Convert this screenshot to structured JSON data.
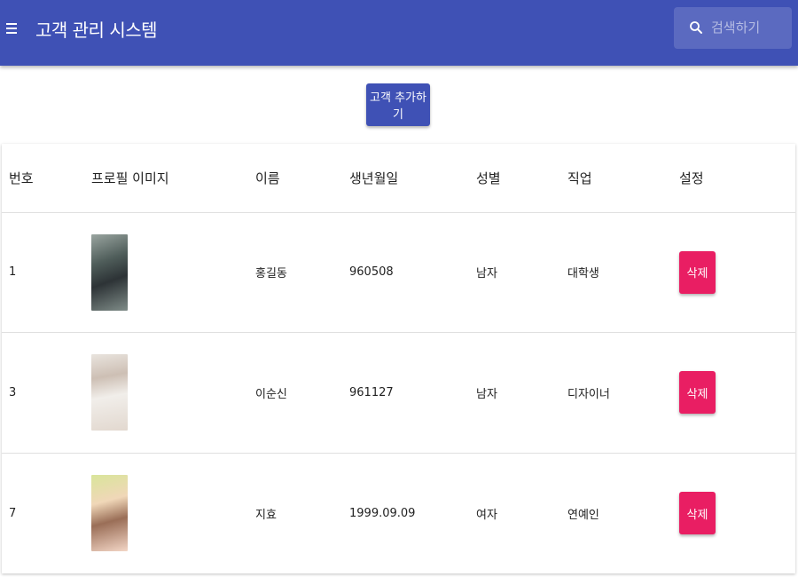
{
  "appbar": {
    "title": "고객 관리 시스템",
    "menu_icon": "menu-icon",
    "search_icon": "search-icon",
    "search_placeholder": "검색하기",
    "search_value": ""
  },
  "actions": {
    "add_label": "고객 추가하기"
  },
  "table": {
    "headers": [
      "번호",
      "프로필 이미지",
      "이름",
      "생년월일",
      "성별",
      "직업",
      "설정"
    ],
    "rows": [
      {
        "id": "1",
        "image": "profile-image",
        "name": "홍길동",
        "birthday": "960508",
        "gender": "남자",
        "job": "대학생",
        "delete_label": "삭제"
      },
      {
        "id": "3",
        "image": "profile-image",
        "name": "이순신",
        "birthday": "961127",
        "gender": "남자",
        "job": "디자이너",
        "delete_label": "삭제"
      },
      {
        "id": "7",
        "image": "profile-image",
        "name": "지효",
        "birthday": "1999.09.09",
        "gender": "여자",
        "job": "연예인",
        "delete_label": "삭제"
      }
    ]
  },
  "colors": {
    "primary": "#3f51b5",
    "accent": "#e91e63"
  }
}
